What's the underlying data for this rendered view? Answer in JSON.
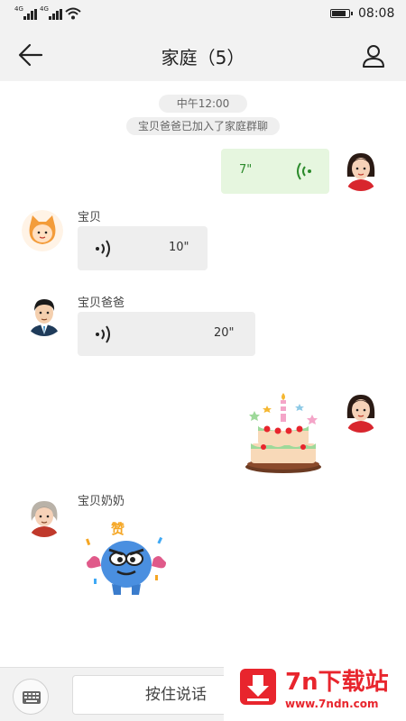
{
  "status_bar": {
    "signal_1": "4G",
    "signal_2": "4G",
    "time": "08:08",
    "battery_level": 0.9
  },
  "header": {
    "title": "家庭（5）",
    "back_icon": "arrow-left-icon",
    "members_icon": "person-icon"
  },
  "chat": {
    "timestamp": "中午12:00",
    "system_message": "宝贝爸爸已加入了家庭群聊",
    "messages": [
      {
        "sender": "",
        "side": "right",
        "type": "voice",
        "duration": "7\""
      },
      {
        "sender": "宝贝",
        "side": "left",
        "type": "voice",
        "duration": "10\""
      },
      {
        "sender": "宝贝爸爸",
        "side": "left",
        "type": "voice",
        "duration": "20\""
      },
      {
        "sender": "",
        "side": "right",
        "type": "sticker",
        "sticker": "birthday-cake"
      },
      {
        "sender": "宝贝奶奶",
        "side": "left",
        "type": "sticker",
        "sticker": "zan-monster",
        "sticker_text": "赞"
      }
    ]
  },
  "input_bar": {
    "keyboard_icon": "keyboard-icon",
    "hold_to_talk": "按住说话"
  },
  "watermark": {
    "name": "7n下载站",
    "url": "www.7ndn.com"
  },
  "colors": {
    "bar_bg": "#f2f2f2",
    "bubble_left": "#eeeeee",
    "bubble_right": "#e6f6df",
    "voice_green": "#2b8a2b",
    "brand_red": "#e8252d"
  }
}
